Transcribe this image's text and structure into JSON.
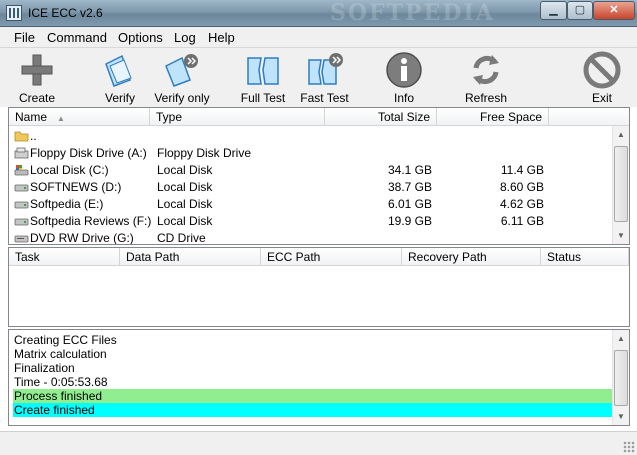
{
  "window": {
    "title": "ICE ECC v2.6",
    "watermark": "SOFTPEDIA",
    "minimize": "▁",
    "maximize": "▢",
    "close": "✕"
  },
  "menu": [
    "File",
    "Command",
    "Options",
    "Log",
    "Help"
  ],
  "toolbar": [
    {
      "label": "Create",
      "icon": "plus-icon"
    },
    {
      "label": "Verify",
      "icon": "verify-icon"
    },
    {
      "label": "Verify only",
      "icon": "verify-only-icon"
    },
    {
      "label": "Full Test",
      "icon": "full-test-icon"
    },
    {
      "label": "Fast Test",
      "icon": "fast-test-icon"
    },
    {
      "label": "Info",
      "icon": "info-icon"
    },
    {
      "label": "Refresh",
      "icon": "refresh-icon"
    },
    {
      "label": "Exit",
      "icon": "exit-icon"
    }
  ],
  "drives": {
    "columns": [
      "Name",
      "Type",
      "Total Size",
      "Free Space"
    ],
    "sort_indicator": "▲",
    "rows": [
      {
        "name": "..",
        "type": "",
        "total": "",
        "free": "",
        "icon": "folder-icon"
      },
      {
        "name": "Floppy Disk Drive (A:)",
        "type": "Floppy Disk Drive",
        "total": "",
        "free": "",
        "icon": "floppy-icon"
      },
      {
        "name": "Local Disk (C:)",
        "type": "Local Disk",
        "total": "34.1 GB",
        "free": "11.4 GB",
        "icon": "windows-drive-icon"
      },
      {
        "name": "SOFTNEWS (D:)",
        "type": "Local Disk",
        "total": "38.7 GB",
        "free": "8.60 GB",
        "icon": "hard-drive-icon"
      },
      {
        "name": "Softpedia (E:)",
        "type": "Local Disk",
        "total": "6.01 GB",
        "free": "4.62 GB",
        "icon": "hard-drive-icon"
      },
      {
        "name": "Softpedia Reviews (F:)",
        "type": "Local Disk",
        "total": "19.9 GB",
        "free": "6.11 GB",
        "icon": "hard-drive-icon"
      },
      {
        "name": "DVD RW Drive (G:)",
        "type": "CD Drive",
        "total": "",
        "free": "",
        "icon": "dvd-drive-icon"
      }
    ]
  },
  "tasks": {
    "columns": [
      "Task",
      "Data Path",
      "ECC Path",
      "Recovery Path",
      "Status"
    ]
  },
  "log": {
    "lines": [
      {
        "text": "Creating ECC Files",
        "bg": ""
      },
      {
        "text": "Matrix calculation",
        "bg": ""
      },
      {
        "text": "Finalization",
        "bg": ""
      },
      {
        "text": "Time - 0:05:53.68",
        "bg": ""
      },
      {
        "text": "Process finished",
        "bg": "#90ee90"
      },
      {
        "text": "Create finished",
        "bg": "#00ffff"
      }
    ]
  },
  "colors": {
    "success": "#90ee90",
    "info": "#00ffff"
  }
}
